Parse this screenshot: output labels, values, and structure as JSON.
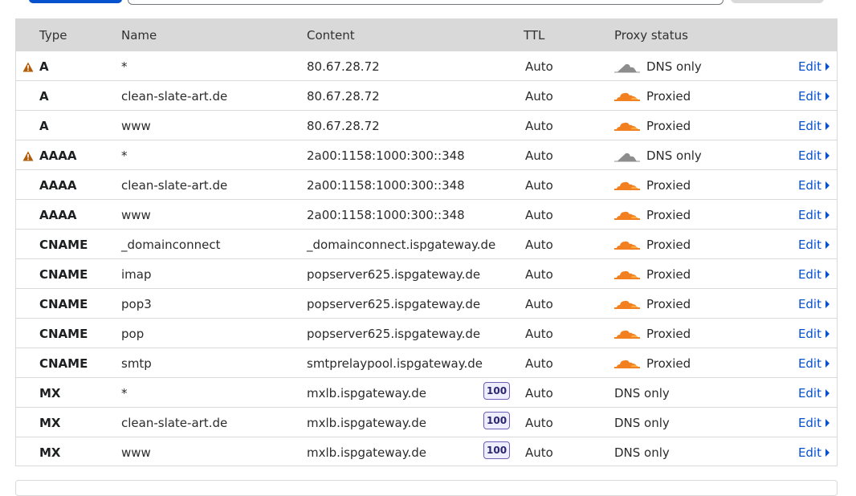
{
  "table": {
    "headers": {
      "type": "Type",
      "name": "Name",
      "content": "Content",
      "ttl": "TTL",
      "proxy_status": "Proxy status"
    },
    "edit_label": "Edit",
    "rows": [
      {
        "type": "A",
        "name": "*",
        "content": "80.67.28.72",
        "priority": "",
        "ttl": "Auto",
        "proxy": "DNS only",
        "proxy_icon": "grey-cloud-icon",
        "warning": true
      },
      {
        "type": "A",
        "name": "clean-slate-art.de",
        "content": "80.67.28.72",
        "priority": "",
        "ttl": "Auto",
        "proxy": "Proxied",
        "proxy_icon": "orange-cloud-icon",
        "warning": false
      },
      {
        "type": "A",
        "name": "www",
        "content": "80.67.28.72",
        "priority": "",
        "ttl": "Auto",
        "proxy": "Proxied",
        "proxy_icon": "orange-cloud-icon",
        "warning": false
      },
      {
        "type": "AAAA",
        "name": "*",
        "content": "2a00:1158:1000:300::348",
        "priority": "",
        "ttl": "Auto",
        "proxy": "DNS only",
        "proxy_icon": "grey-cloud-icon",
        "warning": true
      },
      {
        "type": "AAAA",
        "name": "clean-slate-art.de",
        "content": "2a00:1158:1000:300::348",
        "priority": "",
        "ttl": "Auto",
        "proxy": "Proxied",
        "proxy_icon": "orange-cloud-icon",
        "warning": false
      },
      {
        "type": "AAAA",
        "name": "www",
        "content": "2a00:1158:1000:300::348",
        "priority": "",
        "ttl": "Auto",
        "proxy": "Proxied",
        "proxy_icon": "orange-cloud-icon",
        "warning": false
      },
      {
        "type": "CNAME",
        "name": "_domainconnect",
        "content": "_domainconnect.ispgateway.de",
        "priority": "",
        "ttl": "Auto",
        "proxy": "Proxied",
        "proxy_icon": "orange-cloud-icon",
        "warning": false
      },
      {
        "type": "CNAME",
        "name": "imap",
        "content": "popserver625.ispgateway.de",
        "priority": "",
        "ttl": "Auto",
        "proxy": "Proxied",
        "proxy_icon": "orange-cloud-icon",
        "warning": false
      },
      {
        "type": "CNAME",
        "name": "pop3",
        "content": "popserver625.ispgateway.de",
        "priority": "",
        "ttl": "Auto",
        "proxy": "Proxied",
        "proxy_icon": "orange-cloud-icon",
        "warning": false
      },
      {
        "type": "CNAME",
        "name": "pop",
        "content": "popserver625.ispgateway.de",
        "priority": "",
        "ttl": "Auto",
        "proxy": "Proxied",
        "proxy_icon": "orange-cloud-icon",
        "warning": false
      },
      {
        "type": "CNAME",
        "name": "smtp",
        "content": "smtprelaypool.ispgateway.de",
        "priority": "",
        "ttl": "Auto",
        "proxy": "Proxied",
        "proxy_icon": "orange-cloud-icon",
        "warning": false
      },
      {
        "type": "MX",
        "name": "*",
        "content": "mxlb.ispgateway.de",
        "priority": "100",
        "ttl": "Auto",
        "proxy": "DNS only",
        "proxy_icon": "",
        "warning": false
      },
      {
        "type": "MX",
        "name": "clean-slate-art.de",
        "content": "mxlb.ispgateway.de",
        "priority": "100",
        "ttl": "Auto",
        "proxy": "DNS only",
        "proxy_icon": "",
        "warning": false
      },
      {
        "type": "MX",
        "name": "www",
        "content": "mxlb.ispgateway.de",
        "priority": "100",
        "ttl": "Auto",
        "proxy": "DNS only",
        "proxy_icon": "",
        "warning": false
      }
    ]
  },
  "colors": {
    "accent": "#0551ce",
    "warning": "#b25d0b",
    "proxied_cloud": "#f38020",
    "dns_only_cloud": "#8d8d8d",
    "header_bg": "#d9d9d9",
    "priority_badge_border": "#6b5fb5"
  }
}
